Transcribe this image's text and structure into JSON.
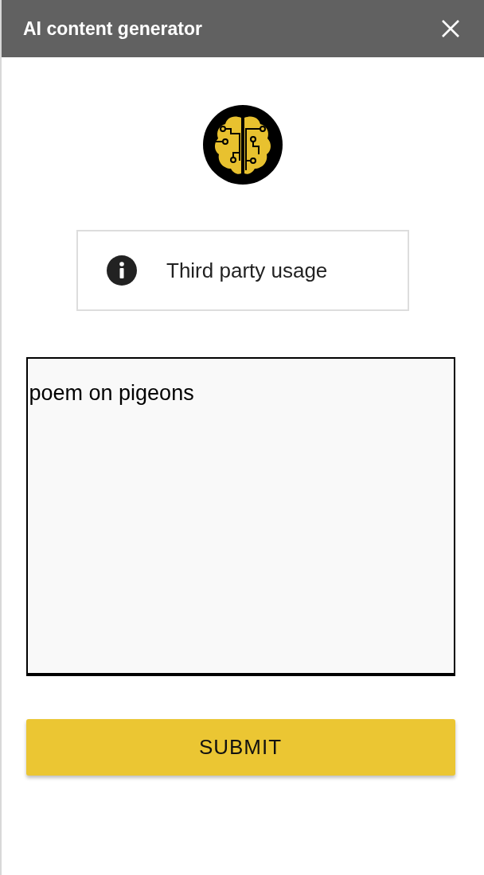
{
  "window": {
    "title": "AI content generator"
  },
  "notice": {
    "label": "Third party usage"
  },
  "prompt": {
    "value": "poem on pigeons"
  },
  "buttons": [
    "SUBMIT"
  ]
}
